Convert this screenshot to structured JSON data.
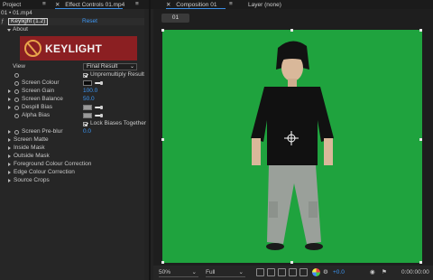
{
  "tabs": {
    "project": "Project",
    "effect_controls": "Effect Controls 01.mp4",
    "composition": "Composition 01",
    "layer": "Layer (none)"
  },
  "effect_controls": {
    "layer_path": "01 • 01.mp4",
    "effect_name": "Keylight (1.2)",
    "reset": "Reset",
    "about": "About",
    "logo_text": "KEYLIGHT",
    "view_label": "View",
    "view_value": "Final Result",
    "unpremultiply": "Unpremultiply Result",
    "screen_colour": "Screen Colour",
    "screen_gain_label": "Screen Gain",
    "screen_gain_value": "100.0",
    "screen_balance_label": "Screen Balance",
    "screen_balance_value": "50.0",
    "despill_bias": "Despill Bias",
    "alpha_bias": "Alpha Bias",
    "lock_biases": "Lock Biases Together",
    "screen_preblur_label": "Screen Pre-blur",
    "screen_preblur_value": "0.0",
    "groups": [
      "Screen Matte",
      "Inside Mask",
      "Outside Mask",
      "Foreground Colour Correction",
      "Edge Colour Correction",
      "Source Crops"
    ],
    "colors": {
      "screen_colour": "#0b0b0b",
      "despill": "#9a9a9a",
      "alpha": "#9a9a9a",
      "accent": "#3d97f5"
    }
  },
  "composition": {
    "comp_tab": "01",
    "bg_color": "#1fa33e"
  },
  "viewer": {
    "zoom": "50%",
    "resolution": "Full",
    "exposure": "+0.0",
    "timecode": "0:00:00:00"
  }
}
